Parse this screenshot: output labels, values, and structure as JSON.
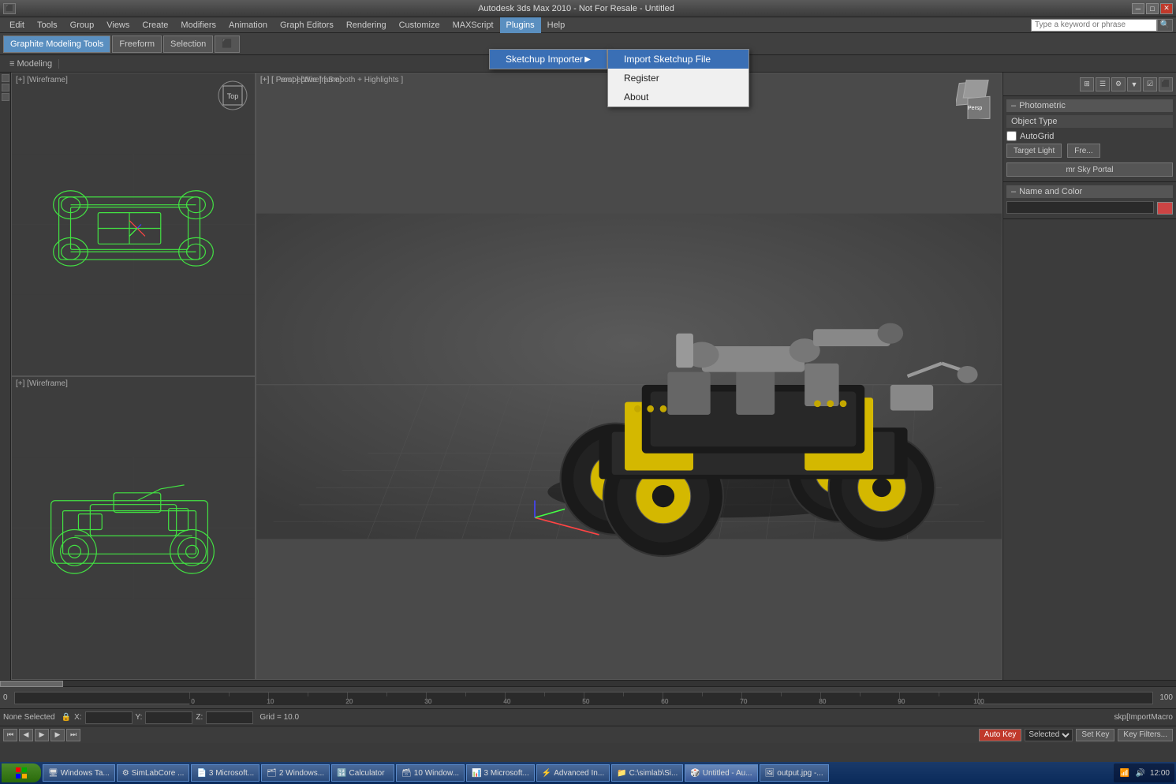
{
  "titlebar": {
    "title": "Autodesk 3ds Max 2010 - Not For Resale - Untitled",
    "minimize": "─",
    "maximize": "□",
    "close": "✕"
  },
  "menubar": {
    "items": [
      {
        "label": "Edit",
        "active": false
      },
      {
        "label": "Tools",
        "active": false
      },
      {
        "label": "Group",
        "active": false
      },
      {
        "label": "Views",
        "active": false
      },
      {
        "label": "Create",
        "active": false
      },
      {
        "label": "Modifiers",
        "active": false
      },
      {
        "label": "Animation",
        "active": false
      },
      {
        "label": "Graph Editors",
        "active": false
      },
      {
        "label": "Rendering",
        "active": false
      },
      {
        "label": "Customize",
        "active": false
      },
      {
        "label": "MAXScript",
        "active": false
      },
      {
        "label": "Plugins",
        "active": true
      },
      {
        "label": "Help",
        "active": false
      }
    ],
    "search_placeholder": "Type a keyword or phrase"
  },
  "toolbar": {
    "tools": [
      {
        "label": "Graphite Modeling Tools"
      },
      {
        "label": "Freeform"
      },
      {
        "label": "Selection"
      },
      {
        "label": "⬛"
      }
    ]
  },
  "modeling_toolbar": {
    "label": "≡ Modeling"
  },
  "plugins_menu": {
    "items": [
      {
        "label": "Sketchup Importer",
        "has_arrow": true,
        "selected": true
      }
    ]
  },
  "sketchup_submenu": {
    "items": [
      {
        "label": "Import Sketchup File",
        "selected": true
      },
      {
        "label": "Register",
        "selected": false
      },
      {
        "label": "About",
        "selected": false
      }
    ]
  },
  "viewports": {
    "top_left": {
      "label": "[+] [Wireframe]",
      "type": "top"
    },
    "top_right": {
      "label": "[+] [ Front ] [Wireframe]",
      "type": "front"
    },
    "bottom_left": {
      "label": "[+] [Wireframe]",
      "type": "left"
    },
    "perspective": {
      "label": "[+] [ Perspective ] [ Smooth + Highlights ]",
      "type": "perspective"
    }
  },
  "right_panel": {
    "section1": {
      "minus": "–",
      "label": "Photometric",
      "object_type_label": "Object Type",
      "autogrid_label": "AutoGrid",
      "target_light_label": "Target Light",
      "free_label": "Fre...",
      "mr_sky_portal_label": "mr Sky Portal"
    },
    "section2": {
      "minus": "–",
      "name_color_label": "Name and Color"
    }
  },
  "status_bar": {
    "selection": "None Selected",
    "x_label": "X:",
    "y_label": "Y:",
    "z_label": "Z:",
    "grid_label": "Grid = 10.0",
    "macro_label": "skp[ImportMacro"
  },
  "timeline": {
    "start": "0",
    "end": "100",
    "markers": [
      "0",
      "10",
      "20",
      "30",
      "40",
      "50",
      "60",
      "70",
      "80",
      "90",
      "100"
    ]
  },
  "anim_controls": {
    "auto_key": "Auto Key",
    "selected_label": "Selected",
    "set_key": "Set Key",
    "key_filters": "Key Filters..."
  },
  "taskbar": {
    "start_label": "Start",
    "buttons": [
      {
        "label": "Windows Ta...",
        "active": false
      },
      {
        "label": "SimLabCore ...",
        "active": false
      },
      {
        "label": "3 Microsoft...",
        "active": false
      },
      {
        "label": "2 Windows...",
        "active": false
      },
      {
        "label": "Calculator",
        "active": false
      },
      {
        "label": "10 Window...",
        "active": false
      },
      {
        "label": "3 Microsoft...",
        "active": false
      },
      {
        "label": "Advanced In...",
        "active": false
      },
      {
        "label": "C:\\simlab\\Si...",
        "active": false
      },
      {
        "label": "Untitled - Au...",
        "active": true
      },
      {
        "label": "output.jpg -...",
        "active": false
      }
    ]
  }
}
